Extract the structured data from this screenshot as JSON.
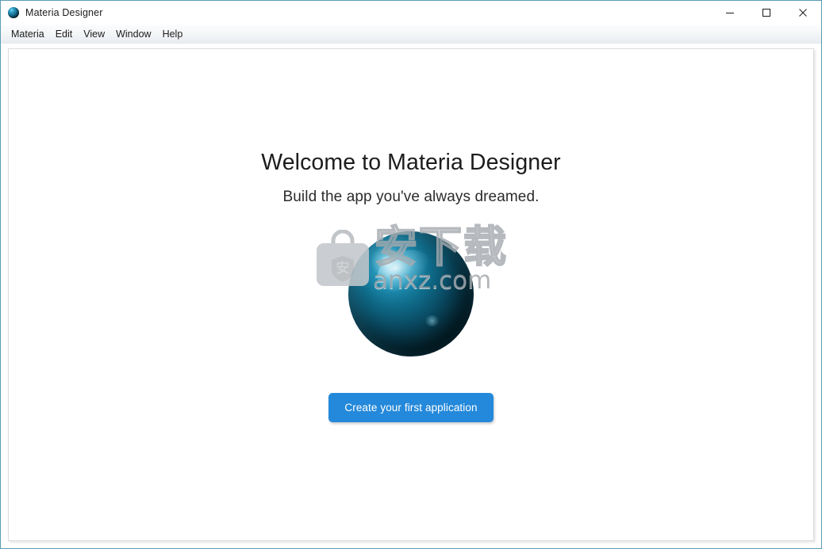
{
  "window": {
    "title": "Materia Designer",
    "app_icon": "sphere-logo-icon",
    "border_color": "#5b9bb8",
    "controls": [
      {
        "name": "minimize",
        "icon": "minimize-icon",
        "label": "—"
      },
      {
        "name": "maximize",
        "icon": "maximize-icon",
        "label": "□"
      },
      {
        "name": "close",
        "icon": "close-icon",
        "label": "✕"
      }
    ]
  },
  "menubar": {
    "items": [
      {
        "id": "materia",
        "label": "Materia"
      },
      {
        "id": "edit",
        "label": "Edit"
      },
      {
        "id": "view",
        "label": "View"
      },
      {
        "id": "window",
        "label": "Window"
      },
      {
        "id": "help",
        "label": "Help"
      }
    ]
  },
  "main": {
    "headline": "Welcome to Materia Designer",
    "subtitle": "Build the app you've always dreamed.",
    "logo": {
      "icon": "sphere-logo-icon",
      "accent_color": "#1d8cb0",
      "shadow_color": "#031a24"
    },
    "cta": {
      "label": "Create your first application",
      "background": "#2489da",
      "text_color": "#ffffff"
    }
  },
  "watermark": {
    "bag_icon": "shopping-bag-icon",
    "bag_glyph": "安",
    "characters": "安下载",
    "url": "anxz.com",
    "color": "#a5aaaf"
  }
}
